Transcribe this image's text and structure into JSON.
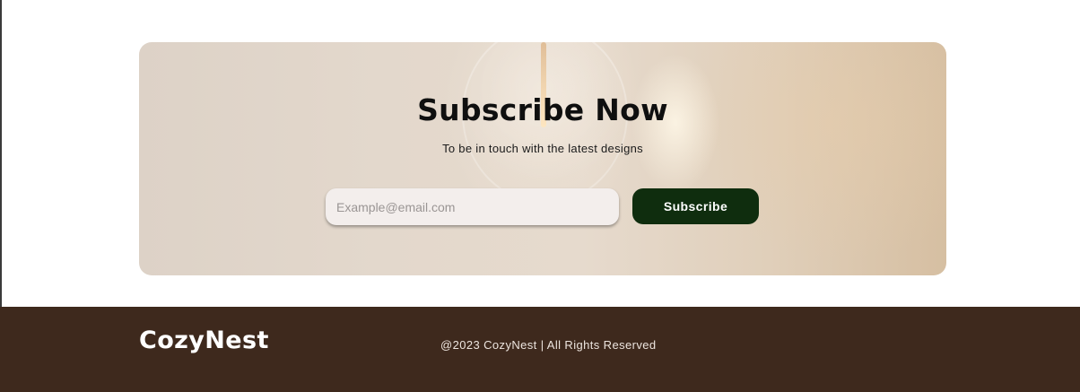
{
  "subscribe": {
    "title": "Subscribe Now",
    "subtitle": "To be in touch with the latest designs",
    "email_placeholder": "Example@email.com",
    "email_value": "",
    "button_label": "Subscribe"
  },
  "footer": {
    "brand": "CozyNest",
    "copyright": "@2023 CozyNest | All Rights Reserved"
  },
  "colors": {
    "button_bg": "#0f2d0e",
    "footer_bg": "#3e291d",
    "card_bg": "#e3d8cc"
  }
}
